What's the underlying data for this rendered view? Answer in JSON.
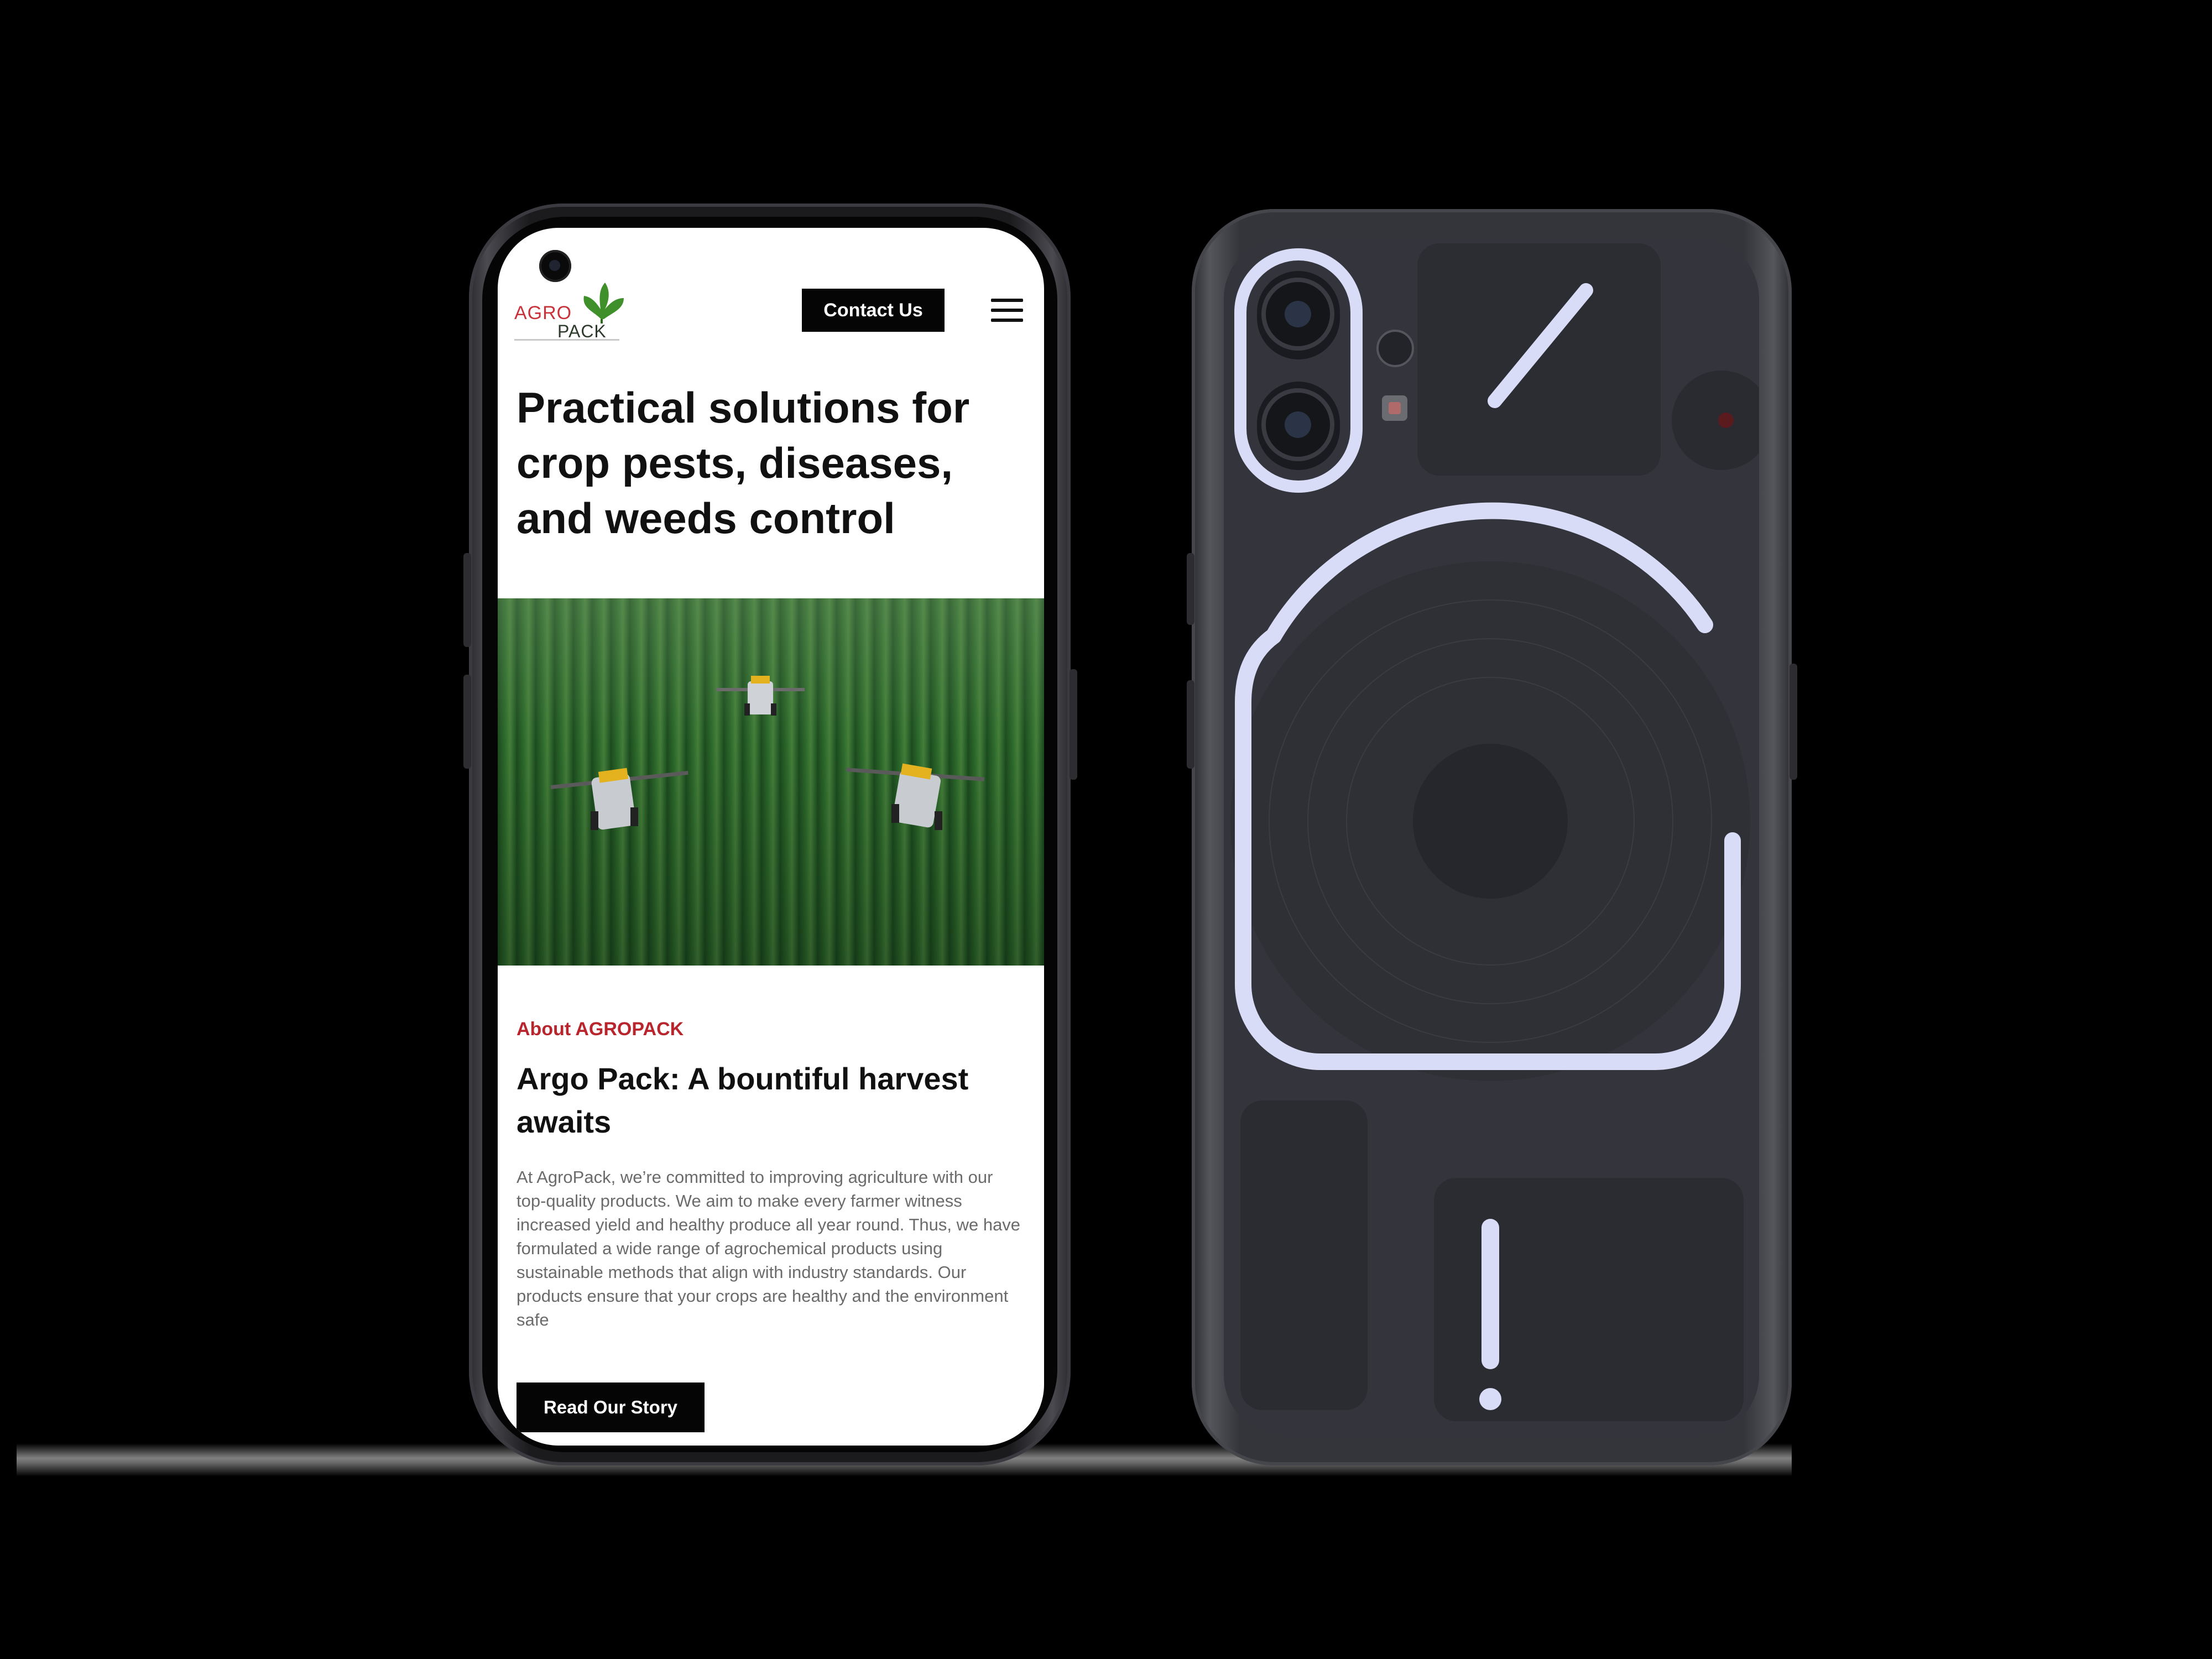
{
  "header": {
    "logo_top": "AGRO",
    "logo_bottom": "PACK",
    "contact_label": "Contact Us"
  },
  "hero": {
    "title": "Practical solutions for crop pests, diseases, and weeds control"
  },
  "about": {
    "label": "About AGROPACK",
    "title": "Argo Pack: A bountiful harvest awaits",
    "body": "At AgroPack, we’re committed to improving agriculture with our top-quality products. We aim to make every farmer witness increased yield and healthy produce all year round. Thus, we have formulated a wide range of agrochemical products using sustainable methods that align with industry standards. Our products ensure that your crops are healthy and the environment safe",
    "cta_label": "Read Our Story"
  },
  "colors": {
    "brand_red": "#b8252d",
    "cta_black": "#050505",
    "glyph_light": "#d9dcf7"
  },
  "icons": [
    "menu-icon",
    "front-camera-icon",
    "leaf-logo-icon"
  ]
}
